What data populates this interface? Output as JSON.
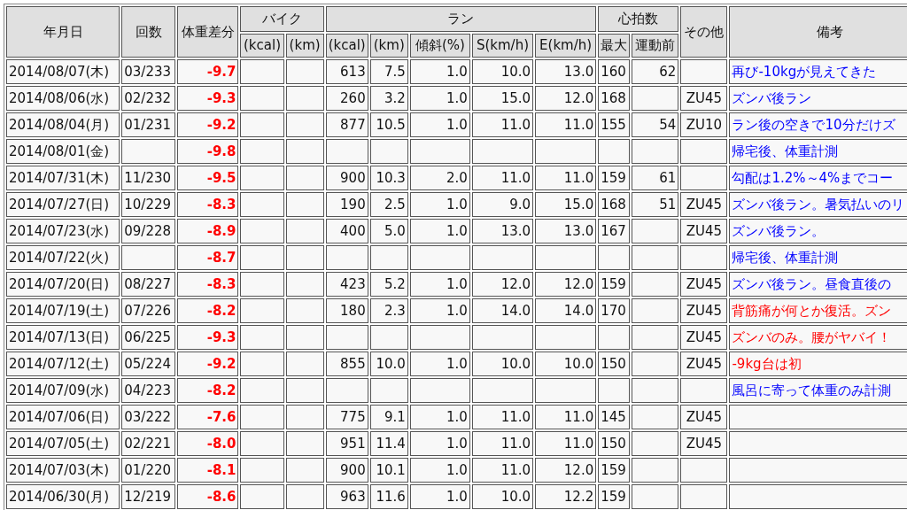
{
  "header": [
    {
      "label": "年月日"
    },
    {
      "label": "回数"
    },
    {
      "label": "体重差分"
    },
    {
      "label": "バイク",
      "subcolumns": [
        "(kcal)",
        "(km)"
      ]
    },
    {
      "label": "ラン",
      "subcolumns": [
        "(kcal)",
        "(km)",
        "傾斜(%)",
        "S(km/h)",
        "E(km/h)"
      ]
    },
    {
      "label": "心拍数",
      "subcolumns": [
        "最大",
        "運動前"
      ]
    },
    {
      "label": "その他"
    },
    {
      "label": "備考"
    }
  ],
  "rows": [
    {
      "date": "2014/08/07(木)",
      "count": "03/233",
      "weight_diff": "-9.7",
      "run_kcal": "613",
      "run_km": "7.5",
      "incline": "1.0",
      "speed_start": "10.0",
      "speed_end": "13.0",
      "hr_max": "160",
      "hr_before": "62",
      "note": {
        "text": "再び-10kgが見えてきた",
        "color": "#0000ff"
      }
    },
    {
      "date": "2014/08/06(水)",
      "count": "02/232",
      "weight_diff": "-9.3",
      "run_kcal": "260",
      "run_km": "3.2",
      "incline": "1.0",
      "speed_start": "15.0",
      "speed_end": "12.0",
      "hr_max": "168",
      "other": "ZU45",
      "note": {
        "text": "ズンバ後ラン",
        "color": "#0000ff"
      }
    },
    {
      "date": "2014/08/04(月)",
      "count": "01/231",
      "weight_diff": "-9.2",
      "run_kcal": "877",
      "run_km": "10.5",
      "incline": "1.0",
      "speed_start": "11.0",
      "speed_end": "11.0",
      "hr_max": "155",
      "hr_before": "54",
      "other": "ZU10",
      "note": {
        "text": "ラン後の空きで10分だけズ",
        "color": "#0000ff"
      }
    },
    {
      "date": "2014/08/01(金)",
      "weight_diff": "-9.8",
      "note": {
        "text": "帰宅後、体重計測",
        "color": "#0000ff"
      }
    },
    {
      "date": "2014/07/31(木)",
      "count": "11/230",
      "weight_diff": "-9.5",
      "run_kcal": "900",
      "run_km": "10.3",
      "incline": "2.0",
      "speed_start": "11.0",
      "speed_end": "11.0",
      "hr_max": "159",
      "hr_before": "61",
      "note": {
        "text": "勾配は1.2%～4%までコー",
        "color": "#0000ff"
      }
    },
    {
      "date": "2014/07/27(日)",
      "count": "10/229",
      "weight_diff": "-8.3",
      "run_kcal": "190",
      "run_km": "2.5",
      "incline": "1.0",
      "speed_start": "9.0",
      "speed_end": "15.0",
      "hr_max": "168",
      "hr_before": "51",
      "other": "ZU45",
      "note": {
        "text": "ズンバ後ラン。暑気払いのリ",
        "color": "#0000ff"
      }
    },
    {
      "date": "2014/07/23(水)",
      "count": "09/228",
      "weight_diff": "-8.9",
      "run_kcal": "400",
      "run_km": "5.0",
      "incline": "1.0",
      "speed_start": "13.0",
      "speed_end": "13.0",
      "hr_max": "167",
      "other": "ZU45",
      "note": {
        "text": "ズンバ後ラン。",
        "color": "#0000ff"
      }
    },
    {
      "date": "2014/07/22(火)",
      "weight_diff": "-8.7",
      "note": {
        "text": "帰宅後、体重計測",
        "color": "#0000ff"
      }
    },
    {
      "date": "2014/07/20(日)",
      "count": "08/227",
      "weight_diff": "-8.3",
      "run_kcal": "423",
      "run_km": "5.2",
      "incline": "1.0",
      "speed_start": "12.0",
      "speed_end": "12.0",
      "hr_max": "159",
      "other": "ZU45",
      "note": {
        "text": "ズンバ後ラン。昼食直後の",
        "color": "#0000ff"
      }
    },
    {
      "date": "2014/07/19(土)",
      "count": "07/226",
      "weight_diff": "-8.2",
      "run_kcal": "180",
      "run_km": "2.3",
      "incline": "1.0",
      "speed_start": "14.0",
      "speed_end": "14.0",
      "hr_max": "170",
      "other": "ZU45",
      "note": {
        "text": "背筋痛が何とか復活。ズン",
        "color": "#ff0000"
      }
    },
    {
      "date": "2014/07/13(日)",
      "count": "06/225",
      "weight_diff": "-9.3",
      "other": "ZU45",
      "note": {
        "text": "ズンバのみ。腰がヤバイ！",
        "color": "#ff0000"
      }
    },
    {
      "date": "2014/07/12(土)",
      "count": "05/224",
      "weight_diff": "-9.2",
      "run_kcal": "855",
      "run_km": "10.0",
      "incline": "1.0",
      "speed_start": "10.0",
      "speed_end": "10.0",
      "hr_max": "150",
      "other": "ZU45",
      "note": {
        "text": "-9kg台は初",
        "color": "#ff0000"
      }
    },
    {
      "date": "2014/07/09(水)",
      "count": "04/223",
      "weight_diff": "-8.2",
      "note": {
        "text": "風呂に寄って体重のみ計測",
        "color": "#0000ff"
      }
    },
    {
      "date": "2014/07/06(日)",
      "count": "03/222",
      "weight_diff": "-7.6",
      "run_kcal": "775",
      "run_km": "9.1",
      "incline": "1.0",
      "speed_start": "11.0",
      "speed_end": "11.0",
      "hr_max": "145",
      "other": "ZU45"
    },
    {
      "date": "2014/07/05(土)",
      "count": "02/221",
      "weight_diff": "-8.0",
      "run_kcal": "951",
      "run_km": "11.4",
      "incline": "1.0",
      "speed_start": "11.0",
      "speed_end": "11.0",
      "hr_max": "150",
      "other": "ZU45"
    },
    {
      "date": "2014/07/03(木)",
      "count": "01/220",
      "weight_diff": "-8.1",
      "run_kcal": "900",
      "run_km": "10.1",
      "incline": "1.0",
      "speed_start": "11.0",
      "speed_end": "12.0",
      "hr_max": "159"
    },
    {
      "date": "2014/06/30(月)",
      "count": "12/219",
      "weight_diff": "-8.6",
      "run_kcal": "963",
      "run_km": "11.6",
      "incline": "1.0",
      "speed_start": "10.0",
      "speed_end": "12.2",
      "hr_max": "159"
    }
  ]
}
